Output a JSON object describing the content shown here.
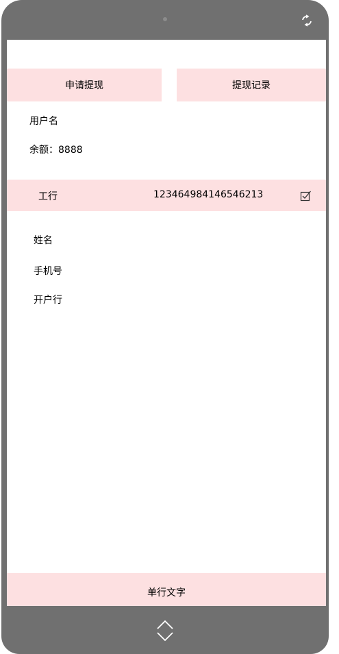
{
  "tabs": {
    "apply_label": "申请提现",
    "records_label": "提现记录"
  },
  "account": {
    "username": "用户名",
    "balance": "余额：8888"
  },
  "bank_card": {
    "bank": "工行",
    "number": "123464984146546213",
    "selected": true
  },
  "form": {
    "name_label": "姓名",
    "phone_label": "手机号",
    "branch_label": "开户行"
  },
  "footer": {
    "text": "单行文字"
  },
  "icons": {
    "rotate": "rotate-icon",
    "checkbox": "checkbox-checked-icon",
    "nav": "up-down-chevron-icon"
  },
  "colors": {
    "device_frame": "#707070",
    "accent_pink": "#fde0e1",
    "screen": "#ffffff"
  }
}
